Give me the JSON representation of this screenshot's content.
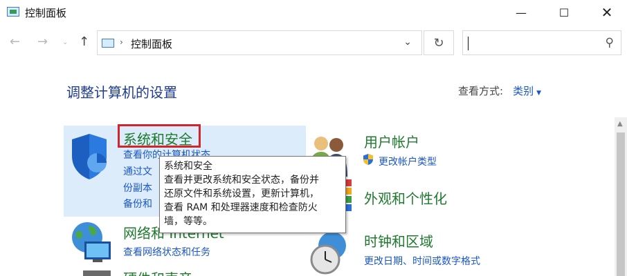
{
  "window": {
    "title": "控制面板",
    "minimize_glyph": "—",
    "maximize_glyph": "☐",
    "close_glyph": "✕"
  },
  "nav": {
    "back_glyph": "←",
    "forward_glyph": "→",
    "history_glyph": "⌄",
    "up_glyph": "↑",
    "breadcrumb_sep": "›",
    "breadcrumb": "控制面板",
    "dropdown_glyph": "⌄",
    "refresh_glyph": "↻",
    "search_glyph": "⚲",
    "search_value": ""
  },
  "main": {
    "title": "调整计算机的设置",
    "view_by_label": "查看方式:",
    "view_by_value": "类别",
    "view_by_arrow": "▼"
  },
  "categories": {
    "security": {
      "title": "系统和安全",
      "links": [
        "查看你的计算机状态",
        "通过文件历史记录保存你的文件备份副本",
        "备份和还原(Windows 7)"
      ],
      "visible_fragments": [
        "查看你的计算机状态",
        "通过文",
        "份副本",
        "备份和"
      ]
    },
    "accounts": {
      "title": "用户帐户",
      "links": [
        "更改帐户类型"
      ]
    },
    "appearance": {
      "title": "外观和个性化"
    },
    "network": {
      "title": "网络和 Internet",
      "links": [
        "查看网络状态和任务"
      ]
    },
    "clock": {
      "title": "时钟和区域",
      "links": [
        "更改日期、时间或数字格式"
      ]
    },
    "hardware": {
      "title": "硬件和声音"
    }
  },
  "tooltip": {
    "lines": [
      "系统和安全",
      "查看并更改系统和安全状态，备份并",
      "还原文件和系统设置，更新计算机，",
      "查看 RAM 和处理器速度和检查防火",
      "墙，等等。"
    ]
  },
  "colors": {
    "category_title": "#1f7a2e",
    "link": "#1a56c8",
    "page_title": "#1f3a93",
    "highlight_bg": "#dcecfb",
    "red_box": "#d0262b"
  }
}
